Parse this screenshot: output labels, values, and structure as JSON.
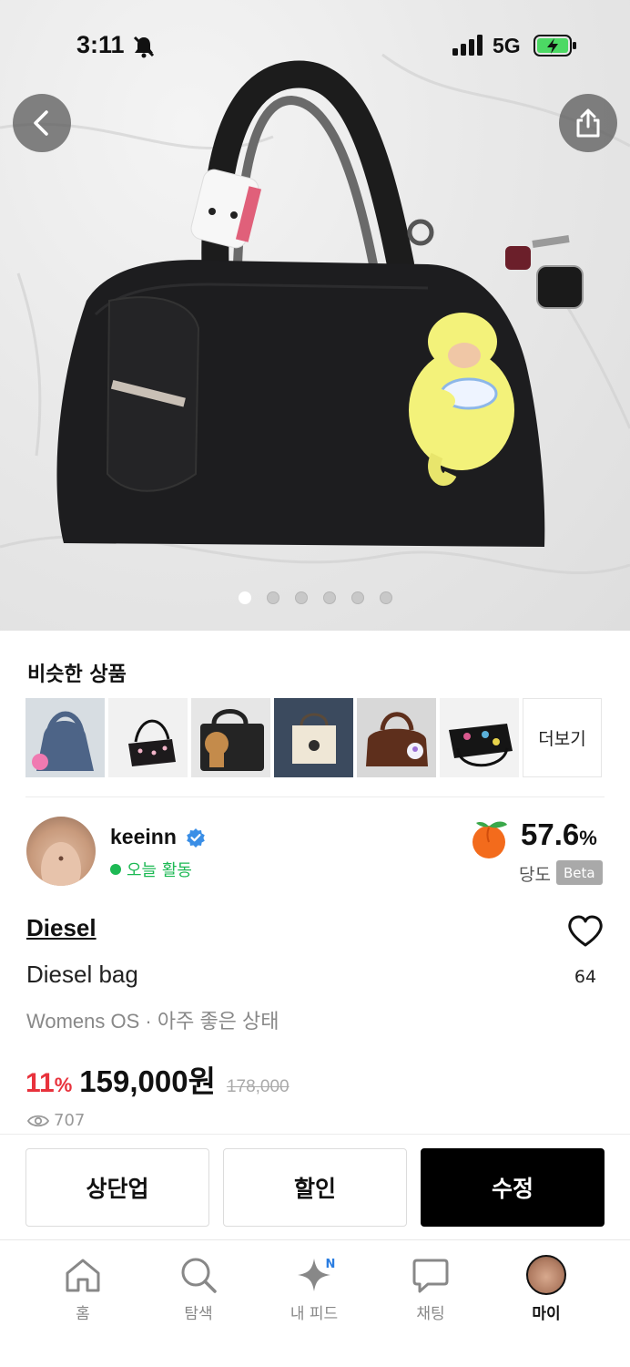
{
  "status_bar": {
    "time": "3:11",
    "network": "5G"
  },
  "similar": {
    "title": "비슷한 상품",
    "more_label": "더보기"
  },
  "seller": {
    "name": "keeinn",
    "activity": "오늘 활동",
    "score": "57.6",
    "score_unit": "%",
    "score_label": "당도",
    "score_badge": "Beta"
  },
  "product": {
    "brand": "Diesel",
    "title": "Diesel bag",
    "meta": "Womens OS · 아주 좋은 상태",
    "discount": "11",
    "discount_unit": "%",
    "price": "159,000원",
    "original_price": "178,000",
    "likes": "64",
    "views": "707"
  },
  "actions": {
    "bump": "상단업",
    "discount": "할인",
    "edit": "수정"
  },
  "tabbar": {
    "home": "홈",
    "search": "탐색",
    "feed": "내 피드",
    "feed_badge": "N",
    "chat": "채팅",
    "my": "마이"
  },
  "carousel": {
    "pages": 6,
    "current": 1
  }
}
